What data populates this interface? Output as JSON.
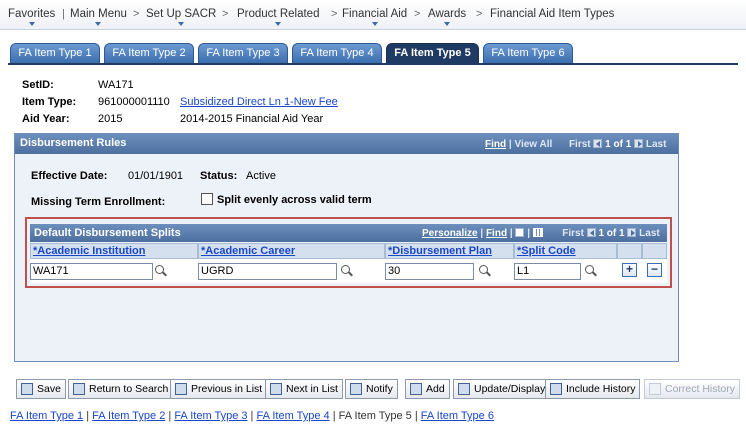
{
  "breadcrumb": [
    "Favorites",
    "Main Menu",
    "Set Up SACR",
    "Product Related",
    "Financial Aid",
    "Awards",
    "Financial Aid Item Types"
  ],
  "tabs": [
    "FA Item Type 1",
    "FA Item Type 2",
    "FA Item Type 3",
    "FA Item Type 4",
    "FA Item Type 5",
    "FA Item Type 6"
  ],
  "active_tab": "FA Item Type 5",
  "header": {
    "setid_label": "SetID:",
    "setid": "WA171",
    "item_type_label": "Item Type:",
    "item_type": "961000001110",
    "item_type_desc": "Subsidized Direct Ln 1-New Fee",
    "aid_year_label": "Aid Year:",
    "aid_year": "2015",
    "aid_year_desc": "2014-2015 Financial Aid Year"
  },
  "rules": {
    "title": "Disbursement Rules",
    "find": "Find",
    "view_all": "View All",
    "first": "First",
    "count": "1 of 1",
    "last": "Last",
    "effective_date_label": "Effective Date:",
    "effective_date": "01/01/1901",
    "status_label": "Status:",
    "status": "Active",
    "missing_term_label": "Missing Term Enrollment:",
    "split_evenly_label": "Split evenly across valid term",
    "split_evenly_checked": false
  },
  "splits": {
    "title": "Default Disbursement Splits",
    "personalize": "Personalize",
    "find": "Find",
    "first": "First",
    "count": "1 of 1",
    "last": "Last",
    "columns": [
      "*Academic Institution",
      "*Academic Career",
      "*Disbursement Plan",
      "*Split Code"
    ],
    "row": {
      "institution": "WA171",
      "career": "UGRD",
      "plan": "30",
      "split_code": "L1"
    }
  },
  "toolbar": {
    "save": "Save",
    "return_to_search": "Return to Search",
    "previous_in_list": "Previous in List",
    "next_in_list": "Next in List",
    "notify": "Notify",
    "add": "Add",
    "update_display": "Update/Display",
    "include_history": "Include History",
    "correct_history": "Correct History"
  },
  "footer_links": [
    "FA Item Type 1",
    "FA Item Type 2",
    "FA Item Type 3",
    "FA Item Type 4",
    "FA Item Type 5",
    "FA Item Type 6"
  ]
}
